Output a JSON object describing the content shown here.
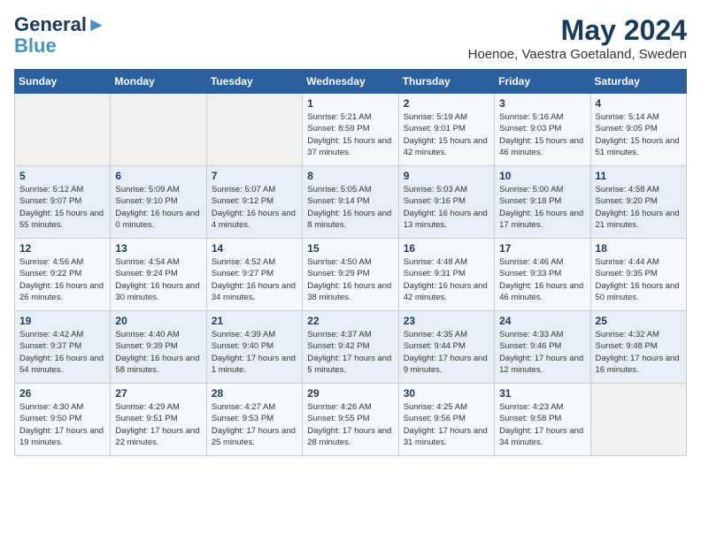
{
  "header": {
    "logo_line1": "General",
    "logo_line2": "Blue",
    "month_year": "May 2024",
    "location": "Hoenoe, Vaestra Goetaland, Sweden"
  },
  "weekdays": [
    "Sunday",
    "Monday",
    "Tuesday",
    "Wednesday",
    "Thursday",
    "Friday",
    "Saturday"
  ],
  "weeks": [
    [
      {
        "day": "",
        "info": ""
      },
      {
        "day": "",
        "info": ""
      },
      {
        "day": "",
        "info": ""
      },
      {
        "day": "1",
        "info": "Sunrise: 5:21 AM\nSunset: 8:59 PM\nDaylight: 15 hours and 37 minutes."
      },
      {
        "day": "2",
        "info": "Sunrise: 5:19 AM\nSunset: 9:01 PM\nDaylight: 15 hours and 42 minutes."
      },
      {
        "day": "3",
        "info": "Sunrise: 5:16 AM\nSunset: 9:03 PM\nDaylight: 15 hours and 46 minutes."
      },
      {
        "day": "4",
        "info": "Sunrise: 5:14 AM\nSunset: 9:05 PM\nDaylight: 15 hours and 51 minutes."
      }
    ],
    [
      {
        "day": "5",
        "info": "Sunrise: 5:12 AM\nSunset: 9:07 PM\nDaylight: 15 hours and 55 minutes."
      },
      {
        "day": "6",
        "info": "Sunrise: 5:09 AM\nSunset: 9:10 PM\nDaylight: 16 hours and 0 minutes."
      },
      {
        "day": "7",
        "info": "Sunrise: 5:07 AM\nSunset: 9:12 PM\nDaylight: 16 hours and 4 minutes."
      },
      {
        "day": "8",
        "info": "Sunrise: 5:05 AM\nSunset: 9:14 PM\nDaylight: 16 hours and 8 minutes."
      },
      {
        "day": "9",
        "info": "Sunrise: 5:03 AM\nSunset: 9:16 PM\nDaylight: 16 hours and 13 minutes."
      },
      {
        "day": "10",
        "info": "Sunrise: 5:00 AM\nSunset: 9:18 PM\nDaylight: 16 hours and 17 minutes."
      },
      {
        "day": "11",
        "info": "Sunrise: 4:58 AM\nSunset: 9:20 PM\nDaylight: 16 hours and 21 minutes."
      }
    ],
    [
      {
        "day": "12",
        "info": "Sunrise: 4:56 AM\nSunset: 9:22 PM\nDaylight: 16 hours and 26 minutes."
      },
      {
        "day": "13",
        "info": "Sunrise: 4:54 AM\nSunset: 9:24 PM\nDaylight: 16 hours and 30 minutes."
      },
      {
        "day": "14",
        "info": "Sunrise: 4:52 AM\nSunset: 9:27 PM\nDaylight: 16 hours and 34 minutes."
      },
      {
        "day": "15",
        "info": "Sunrise: 4:50 AM\nSunset: 9:29 PM\nDaylight: 16 hours and 38 minutes."
      },
      {
        "day": "16",
        "info": "Sunrise: 4:48 AM\nSunset: 9:31 PM\nDaylight: 16 hours and 42 minutes."
      },
      {
        "day": "17",
        "info": "Sunrise: 4:46 AM\nSunset: 9:33 PM\nDaylight: 16 hours and 46 minutes."
      },
      {
        "day": "18",
        "info": "Sunrise: 4:44 AM\nSunset: 9:35 PM\nDaylight: 16 hours and 50 minutes."
      }
    ],
    [
      {
        "day": "19",
        "info": "Sunrise: 4:42 AM\nSunset: 9:37 PM\nDaylight: 16 hours and 54 minutes."
      },
      {
        "day": "20",
        "info": "Sunrise: 4:40 AM\nSunset: 9:39 PM\nDaylight: 16 hours and 58 minutes."
      },
      {
        "day": "21",
        "info": "Sunrise: 4:39 AM\nSunset: 9:40 PM\nDaylight: 17 hours and 1 minute."
      },
      {
        "day": "22",
        "info": "Sunrise: 4:37 AM\nSunset: 9:42 PM\nDaylight: 17 hours and 5 minutes."
      },
      {
        "day": "23",
        "info": "Sunrise: 4:35 AM\nSunset: 9:44 PM\nDaylight: 17 hours and 9 minutes."
      },
      {
        "day": "24",
        "info": "Sunrise: 4:33 AM\nSunset: 9:46 PM\nDaylight: 17 hours and 12 minutes."
      },
      {
        "day": "25",
        "info": "Sunrise: 4:32 AM\nSunset: 9:48 PM\nDaylight: 17 hours and 16 minutes."
      }
    ],
    [
      {
        "day": "26",
        "info": "Sunrise: 4:30 AM\nSunset: 9:50 PM\nDaylight: 17 hours and 19 minutes."
      },
      {
        "day": "27",
        "info": "Sunrise: 4:29 AM\nSunset: 9:51 PM\nDaylight: 17 hours and 22 minutes."
      },
      {
        "day": "28",
        "info": "Sunrise: 4:27 AM\nSunset: 9:53 PM\nDaylight: 17 hours and 25 minutes."
      },
      {
        "day": "29",
        "info": "Sunrise: 4:26 AM\nSunset: 9:55 PM\nDaylight: 17 hours and 28 minutes."
      },
      {
        "day": "30",
        "info": "Sunrise: 4:25 AM\nSunset: 9:56 PM\nDaylight: 17 hours and 31 minutes."
      },
      {
        "day": "31",
        "info": "Sunrise: 4:23 AM\nSunset: 9:58 PM\nDaylight: 17 hours and 34 minutes."
      },
      {
        "day": "",
        "info": ""
      }
    ]
  ]
}
